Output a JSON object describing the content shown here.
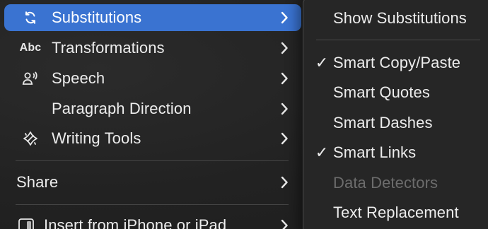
{
  "main_menu": {
    "items": [
      {
        "label": "Substitutions",
        "icon": "substitutions-icon",
        "highlighted": true,
        "has_submenu": true
      },
      {
        "label": "Transformations",
        "icon": "abc-icon",
        "icon_text": "Abc",
        "has_submenu": true
      },
      {
        "label": "Speech",
        "icon": "speech-icon",
        "has_submenu": true
      },
      {
        "label": "Paragraph Direction",
        "icon": "",
        "has_submenu": true
      },
      {
        "label": "Writing Tools",
        "icon": "writing-tools-icon",
        "has_submenu": true
      },
      {
        "label": "Share",
        "icon": "",
        "has_submenu": true
      },
      {
        "label": "Insert from iPhone or iPad",
        "icon": "iphone-icon",
        "has_submenu": true
      }
    ]
  },
  "submenu": {
    "items": [
      {
        "label": "Show Substitutions",
        "checked": false,
        "enabled": true
      },
      {
        "label": "Smart Copy/Paste",
        "checked": true,
        "enabled": true
      },
      {
        "label": "Smart Quotes",
        "checked": false,
        "enabled": true
      },
      {
        "label": "Smart Dashes",
        "checked": false,
        "enabled": true
      },
      {
        "label": "Smart Links",
        "checked": true,
        "enabled": true
      },
      {
        "label": "Data Detectors",
        "checked": false,
        "enabled": false
      },
      {
        "label": "Text Replacement",
        "checked": false,
        "enabled": true
      }
    ],
    "check_glyph": "✓"
  },
  "colors": {
    "highlight": "#3a73d1",
    "menu_background": "#262626",
    "text": "#ececec",
    "disabled_text": "#6c6c6c"
  }
}
